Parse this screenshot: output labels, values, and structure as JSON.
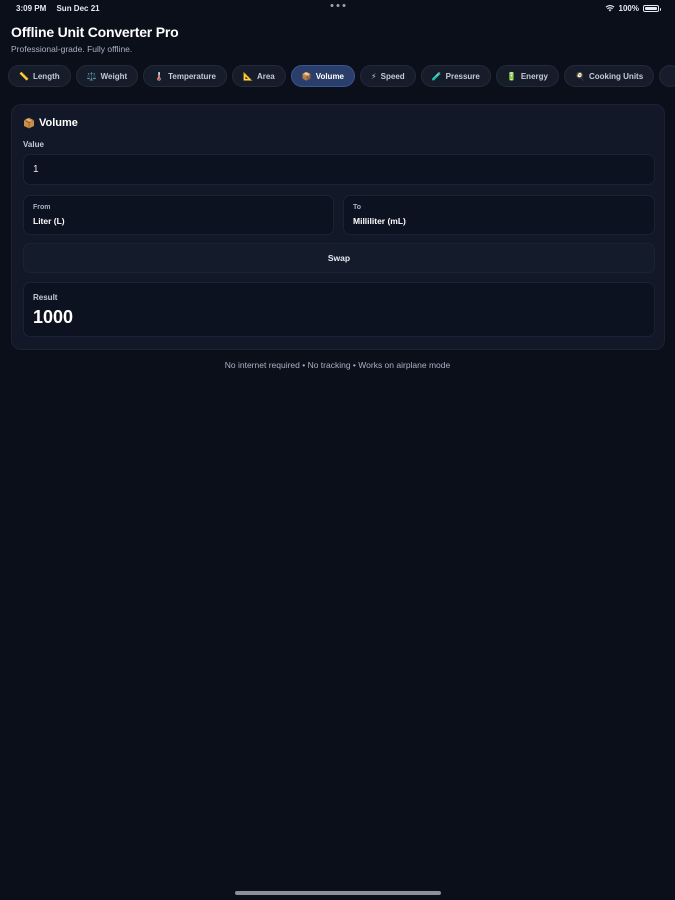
{
  "status_bar": {
    "time": "3:09 PM",
    "date": "Sun Dec 21",
    "battery": "100%",
    "battery_level": 1.0
  },
  "header": {
    "title": "Offline Unit Converter Pro",
    "subtitle": "Professional-grade. Fully offline."
  },
  "tabs": [
    {
      "icon": "📏",
      "label": "Length",
      "active": false
    },
    {
      "icon": "⚖️",
      "label": "Weight",
      "active": false
    },
    {
      "icon": "🌡️",
      "label": "Temperature",
      "active": false
    },
    {
      "icon": "📐",
      "label": "Area",
      "active": false
    },
    {
      "icon": "📦",
      "label": "Volume",
      "active": true
    },
    {
      "icon": "⚡",
      "label": "Speed",
      "active": false
    },
    {
      "icon": "🧪",
      "label": "Pressure",
      "active": false
    },
    {
      "icon": "🔋",
      "label": "Energy",
      "active": false
    },
    {
      "icon": "🍳",
      "label": "Cooking Units",
      "active": false
    }
  ],
  "converter": {
    "title": "Volume",
    "value_label": "Value",
    "value": "1",
    "from_label": "From",
    "from_value": "Liter (L)",
    "to_label": "To",
    "to_value": "Milliliter (mL)",
    "swap_label": "Swap",
    "result_label": "Result",
    "result_value": "1000"
  },
  "footer": {
    "note": "No internet required • No tracking • Works on airplane mode"
  },
  "colors": {
    "background": "#0b0f19",
    "card": "#121827",
    "active_tab": "#2a3e6c"
  }
}
